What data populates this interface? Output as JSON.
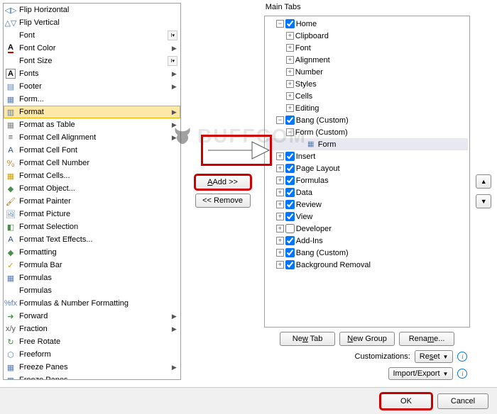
{
  "left_commands": [
    {
      "icon_name": "flip-horizontal-icon",
      "label": "Flip Horizontal",
      "glyph": "◁▷",
      "glyph_color": "#3a6fa8"
    },
    {
      "icon_name": "flip-vertical-icon",
      "label": "Flip Vertical",
      "glyph": "△▽",
      "glyph_color": "#3a6fa8"
    },
    {
      "icon_name": "font-icon",
      "label": "Font",
      "has_dropdown": true,
      "glyph": ""
    },
    {
      "icon_name": "font-color-icon",
      "label": "Font Color",
      "has_arrow": true,
      "glyph": "A",
      "underline_color": "#c00"
    },
    {
      "icon_name": "font-size-icon",
      "label": "Font Size",
      "has_dropdown": true,
      "glyph": ""
    },
    {
      "icon_name": "fonts-icon",
      "label": "Fonts",
      "has_arrow": true,
      "glyph": "A",
      "box": true
    },
    {
      "icon_name": "footer-icon",
      "label": "Footer",
      "has_arrow": true,
      "glyph": "▤",
      "glyph_color": "#5a7fb0"
    },
    {
      "icon_name": "form-icon",
      "label": "Form...",
      "glyph": "▦",
      "glyph_color": "#5a7fb0"
    },
    {
      "icon_name": "format-icon",
      "label": "Format",
      "hover": true,
      "has_arrow": true,
      "glyph": "▥",
      "glyph_color": "#5a7fb0"
    },
    {
      "icon_name": "format-table-icon",
      "label": "Format as Table",
      "has_arrow": true,
      "glyph": "▦",
      "glyph_color": "#888"
    },
    {
      "icon_name": "format-align-icon",
      "label": "Format Cell Alignment",
      "has_arrow": true,
      "glyph": "≡",
      "glyph_color": "#555"
    },
    {
      "icon_name": "format-font-icon",
      "label": "Format Cell Font",
      "glyph": "A",
      "glyph_color": "#2a4d80"
    },
    {
      "icon_name": "format-number-icon",
      "label": "Format Cell Number",
      "glyph": "⁰⁄₀",
      "glyph_color": "#a86b00"
    },
    {
      "icon_name": "format-cells-icon",
      "label": "Format Cells...",
      "glyph": "▦",
      "glyph_color": "#d4a000"
    },
    {
      "icon_name": "format-object-icon",
      "label": "Format Object...",
      "glyph": "◆",
      "glyph_color": "#4a8c4a"
    },
    {
      "icon_name": "format-painter-icon",
      "label": "Format Painter",
      "glyph": "🖌",
      "glyph_color": "#a86b00"
    },
    {
      "icon_name": "format-picture-icon",
      "label": "Format Picture",
      "glyph": "🖼",
      "glyph_color": "#5a7fb0"
    },
    {
      "icon_name": "format-selection-icon",
      "label": "Format Selection",
      "glyph": "◧",
      "glyph_color": "#4a8c4a"
    },
    {
      "icon_name": "format-text-effects-icon",
      "label": "Format Text Effects...",
      "glyph": "A",
      "glyph_color": "#2a4d80"
    },
    {
      "icon_name": "formatting-icon",
      "label": "Formatting",
      "glyph": "◆",
      "glyph_color": "#4a8c4a"
    },
    {
      "icon_name": "formula-bar-icon",
      "label": "Formula Bar",
      "glyph": "✓",
      "glyph_color": "#c8a000"
    },
    {
      "icon_name": "formulas-icon",
      "label": "Formulas",
      "glyph": "▦",
      "glyph_color": "#5a7fb0"
    },
    {
      "icon_name": "formulas2-icon",
      "label": "Formulas",
      "glyph": ""
    },
    {
      "icon_name": "formulas-number-icon",
      "label": "Formulas & Number Formatting",
      "glyph": "%fx",
      "glyph_color": "#5a7fb0"
    },
    {
      "icon_name": "forward-icon",
      "label": "Forward",
      "has_arrow": true,
      "glyph": "➜",
      "glyph_color": "#4a8c4a"
    },
    {
      "icon_name": "fraction-icon",
      "label": "Fraction",
      "has_arrow": true,
      "glyph": "x/y",
      "glyph_color": "#555"
    },
    {
      "icon_name": "free-rotate-icon",
      "label": "Free Rotate",
      "glyph": "↻",
      "glyph_color": "#4a8c4a"
    },
    {
      "icon_name": "freeform-icon",
      "label": "Freeform",
      "glyph": "⬡",
      "glyph_color": "#5a7fb0"
    },
    {
      "icon_name": "freeze-panes-icon",
      "label": "Freeze Panes",
      "has_arrow": true,
      "glyph": "▦",
      "glyph_color": "#5a7fb0"
    },
    {
      "icon_name": "freeze-panes2-icon",
      "label": "Freeze Panes",
      "glyph": "▦",
      "glyph_color": "#5a7fb0"
    }
  ],
  "middle": {
    "add_label": "Add >>",
    "remove_label": "<< Remove"
  },
  "right": {
    "heading": "Main Tabs",
    "tabs": [
      {
        "label": "Home",
        "checked": true,
        "expanded": true,
        "children_kind": "groups",
        "children": [
          {
            "label": "Clipboard"
          },
          {
            "label": "Font"
          },
          {
            "label": "Alignment"
          },
          {
            "label": "Number"
          },
          {
            "label": "Styles"
          },
          {
            "label": "Cells"
          },
          {
            "label": "Editing"
          }
        ]
      },
      {
        "label": "Bang (Custom)",
        "checked": true,
        "expanded": true,
        "children_kind": "custom",
        "children": [
          {
            "label": "Form (Custom)",
            "expanded": true,
            "children": [
              {
                "label": "Form",
                "selected": true,
                "icon": "form"
              }
            ]
          }
        ]
      },
      {
        "label": "Insert",
        "checked": true
      },
      {
        "label": "Page Layout",
        "checked": true
      },
      {
        "label": "Formulas",
        "checked": true
      },
      {
        "label": "Data",
        "checked": true
      },
      {
        "label": "Review",
        "checked": true
      },
      {
        "label": "View",
        "checked": true
      },
      {
        "label": "Developer",
        "checked": false
      },
      {
        "label": "Add-Ins",
        "checked": true
      },
      {
        "label": "Bang (Custom)",
        "checked": true
      },
      {
        "label": "Background Removal",
        "checked": true
      }
    ],
    "new_tab_label": "New Tab",
    "new_group_label": "New Group",
    "rename_label": "Rename...",
    "customizations_label": "Customizations:",
    "reset_label": "Reset",
    "import_export_label": "Import/Export"
  },
  "footer": {
    "ok_label": "OK",
    "cancel_label": "Cancel"
  },
  "watermark": "BUFFCOM"
}
